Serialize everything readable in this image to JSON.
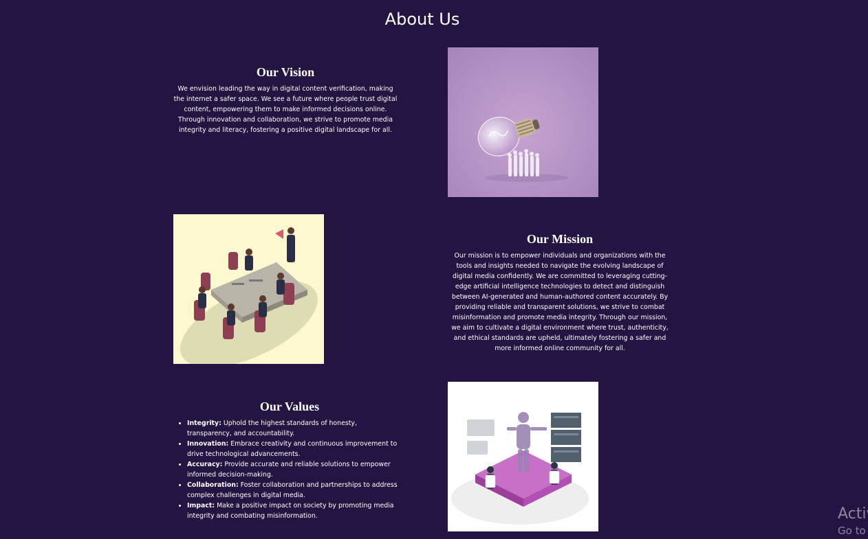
{
  "page": {
    "title": "About Us"
  },
  "vision": {
    "heading": "Our Vision",
    "text": "We envision leading the way in digital content verification, making the internet a safer space. We see a future where people trust digital content, empowering them to make informed decisions online. Through innovation and collaboration, we strive to promote media integrity and literacy, fostering a positive digital landscape for all.",
    "image_icon": "lightbulb-illustration"
  },
  "mission": {
    "heading": "Our Mission",
    "text": "Our mission is to empower individuals and organizations with the tools and insights needed to navigate the evolving landscape of digital media confidently. We are committed to leveraging cutting-edge artificial intelligence technologies to detect and distinguish between AI-generated and human-authored content accurately. By providing reliable and transparent solutions, we strive to combat misinformation and promote media integrity. Through our mission, we aim to cultivate a digital environment where trust, authenticity, and ethical standards are upheld, ultimately fostering a safer and more informed online community for all.",
    "image_icon": "team-meeting-illustration"
  },
  "values": {
    "heading": "Our Values",
    "items": [
      {
        "term": "Integrity:",
        "desc": " Uphold the highest standards of honesty, transparency, and accountability."
      },
      {
        "term": "Innovation:",
        "desc": " Embrace creativity and continuous improvement to drive technological advancements."
      },
      {
        "term": "Accuracy:",
        "desc": " Provide accurate and reliable solutions to empower informed decision-making."
      },
      {
        "term": "Collaboration:",
        "desc": " Foster collaboration and partnerships to address complex challenges in digital media."
      },
      {
        "term": "Impact:",
        "desc": " Make a positive impact on society by promoting media integrity and combating misinformation."
      }
    ],
    "image_icon": "ai-robot-illustration"
  },
  "watermark": {
    "line1": "Activ",
    "line2": "Go to"
  },
  "colors": {
    "background": "#241441",
    "text": "#ffffff",
    "watermark": "#8e86a0"
  }
}
